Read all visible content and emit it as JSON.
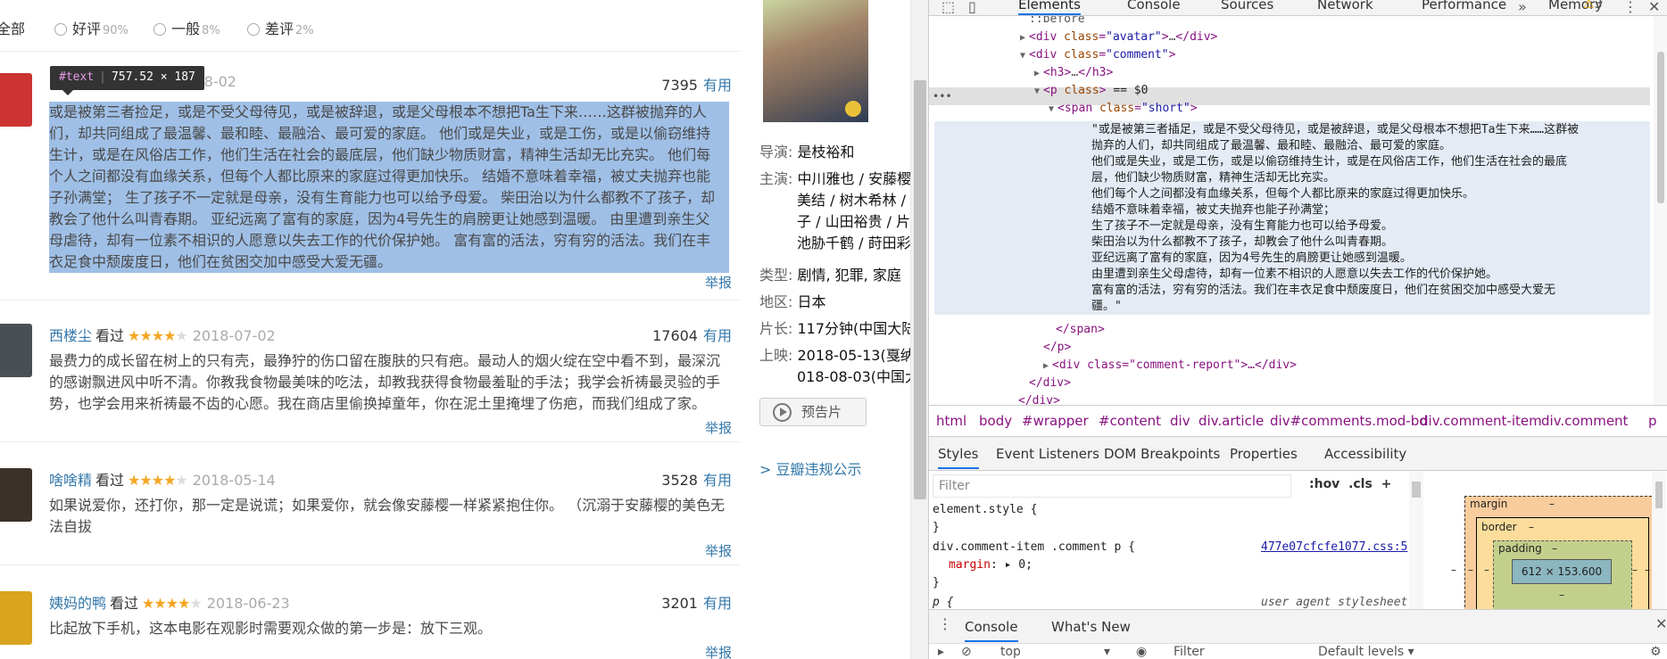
{
  "filters": [
    {
      "label": "全部",
      "pct": ""
    },
    {
      "label": "好评",
      "pct": "90%"
    },
    {
      "label": "一般",
      "pct": "8%"
    },
    {
      "label": "差评",
      "pct": "2%"
    }
  ],
  "tooltip": {
    "tag": "#text",
    "size": "757.52 × 187"
  },
  "comments": [
    {
      "user": "",
      "seen": "",
      "stars": 0,
      "date": "2018-08-02",
      "votes": "7395",
      "useful": "有用",
      "lines": [
        "或是被第三者捡足，或是不受父母待见，或是被辞退，或是父母根本不想把Ta生下来……这群被抛弃的人",
        "们，却共同组成了最温馨、最和睦、最融洽、最可爱的家庭。 他们或是失业，或是工伤，或是以偷窃维持",
        "生计，或是在风俗店工作，他们生活在社会的最底层，他们缺少物质财富，精神生活却无比充实。 他们每",
        "个人之间都没有血缘关系，但每个人都比原来的家庭过得更加快乐。 结婚不意味着幸福，被丈夫抛弃也能",
        "子孙满堂； 生了孩子不一定就是母亲，没有生育能力也可以给予母爱。 柴田治以为什么都教不了孩子，却",
        "教会了他什么叫青春期。 亚纪远离了富有的家庭，因为4号先生的肩膀更让她感到温暖。 由里遭到亲生父",
        "母虐待，却有一位素不相识的人愿意以失去工作的代价保护她。 富有富的活法，穷有穷的活法。我们在丰",
        "衣足食中颓废度日，他们在贫困交加中感受大爱无疆。"
      ],
      "report": "举报"
    },
    {
      "user": "西楼尘",
      "seen": "看过",
      "stars": 4,
      "date": "2018-07-02",
      "votes": "17604",
      "useful": "有用",
      "lines": [
        "最费力的成长留在树上的只有壳，最狰狞的伤口留在腹肤的只有疤。最动人的烟火绽在空中看不到，最深沉",
        "的感谢飘进风中听不清。你教我食物最美味的吃法，却教我获得食物最羞耻的手法；我学会祈祷最灵验的手",
        "势，也学会用来祈祷最不齿的心愿。我在商店里偷换掉童年，你在泥土里掩埋了伤疤，而我们组成了家。"
      ],
      "report": "举报"
    },
    {
      "user": "啥啥精",
      "seen": "看过",
      "stars": 4,
      "date": "2018-05-14",
      "votes": "3528",
      "useful": "有用",
      "lines": [
        "如果说爱你，还打你，那一定是说谎；如果爱你，就会像安藤樱一样紧紧抱住你。 （沉溺于安藤樱的美色无",
        "法自拔"
      ],
      "report": "举报"
    },
    {
      "user": "姨妈的鸭",
      "seen": "看过",
      "stars": 4,
      "date": "2018-06-23",
      "votes": "3201",
      "useful": "有用",
      "lines": [
        "比起放下手机，这本电影在观影时需要观众做的第一步是：放下三观。"
      ],
      "report": "举报"
    }
  ],
  "movie": {
    "director": {
      "k": "导演:",
      "v": "是枝裕和"
    },
    "cast": {
      "k": "主演:",
      "v": [
        "中川雅也 / 安藤樱",
        "美结 / 树木希林 /",
        "子 / 山田裕贵 / 片",
        "池胁千鹤 / 莳田彩"
      ]
    },
    "genre": {
      "k": "类型:",
      "v": "剧情, 犯罪, 家庭"
    },
    "region": {
      "k": "地区:",
      "v": "日本"
    },
    "length": {
      "k": "片长:",
      "v": "117分钟(中国大陆"
    },
    "release": {
      "k": "上映:",
      "v": [
        "2018-05-13(戛纳电",
        "018-08-03(中国大"
      ]
    },
    "trailer": "预告片",
    "notice": "> 豆瓣违规公示"
  },
  "devtools": {
    "tabs": [
      "Elements",
      "Console",
      "Sources",
      "Network",
      "Performance",
      "Memory"
    ],
    "more": "»",
    "warnings": "3",
    "tree": [
      {
        "indent": 0,
        "text": "::before"
      },
      {
        "indent": 1,
        "tag": "div",
        "cls": "avatar",
        "collapsed": true
      },
      {
        "indent": 1,
        "tag": "div",
        "cls": "comment",
        "open": true
      },
      {
        "indent": 2,
        "tag": "h3",
        "collapsed": true
      },
      {
        "indent": 2,
        "tag": "p",
        "cls": "",
        "selected": true,
        "eq": "== $0"
      },
      {
        "indent": 3,
        "tag": "span",
        "cls": "short",
        "open": true
      }
    ],
    "text_lines": [
      "\"或是被第三者插足，或是不受父母待见，或是被辞退，或是父母根本不想把Ta生下来……这群被",
      "抛弃的人们，却共同组成了最温馨、最和睦、最融洽、最可爱的家庭。",
      "他们或是失业，或是工伤，或是以偷窃维持生计，或是在风俗店工作，他们生活在社会的最底",
      "层，他们缺少物质财富，精神生活却无比充实。",
      "他们每个人之间都没有血缘关系，但每个人都比原来的家庭过得更加快乐。",
      "结婚不意味着幸福，被丈夫抛弃也能子孙满堂；",
      "生了孩子不一定就是母亲，没有生育能力也可以给予母爱。",
      "柴田治以为什么都教不了孩子，却教会了他什么叫青春期。",
      "亚纪远离了富有的家庭，因为4号先生的肩膀更让她感到温暖。",
      "由里遭到亲生父母虐待，却有一位素不相识的人愿意以失去工作的代价保护她。",
      "富有富的活法，穷有穷的活法。我们在丰衣足食中颓废度日，他们在贫困交加中感受大爱无",
      "疆。\""
    ],
    "close_lines": [
      "</span>",
      "</p>",
      "<div class=\"comment-report\">…</div>",
      "</div>",
      "</div>"
    ],
    "crumbs": [
      "html",
      "body",
      "#wrapper",
      "#content",
      "div",
      "div.article",
      "div#comments.mod-bd",
      "div.comment-item",
      "div.comment",
      "p"
    ],
    "subtabs": [
      "Styles",
      "Event Listeners",
      "DOM Breakpoints",
      "Properties",
      "Accessibility"
    ],
    "filter_placeholder": "Filter",
    "hov": ":hov",
    "cls": ".cls",
    "rules": [
      {
        "sel": "element.style {"
      },
      {
        "sel": "}"
      },
      {
        "sel": "div.comment-item .comment p {",
        "link": "477e07cfcfe1077.css:5"
      },
      {
        "prop": "margin",
        "val": "0;"
      },
      {
        "sel": "}"
      },
      {
        "sel": "p {",
        "ua": "user agent stylesheet"
      }
    ],
    "boxmodel": {
      "margin": "margin",
      "border": "border",
      "padding": "padding",
      "content": "612 × 153.600",
      "dash": "–"
    },
    "drawer": {
      "tabs": [
        "Console",
        "What's New"
      ],
      "context": "top",
      "filter": "Filter",
      "levels": "Default levels ▾"
    }
  }
}
